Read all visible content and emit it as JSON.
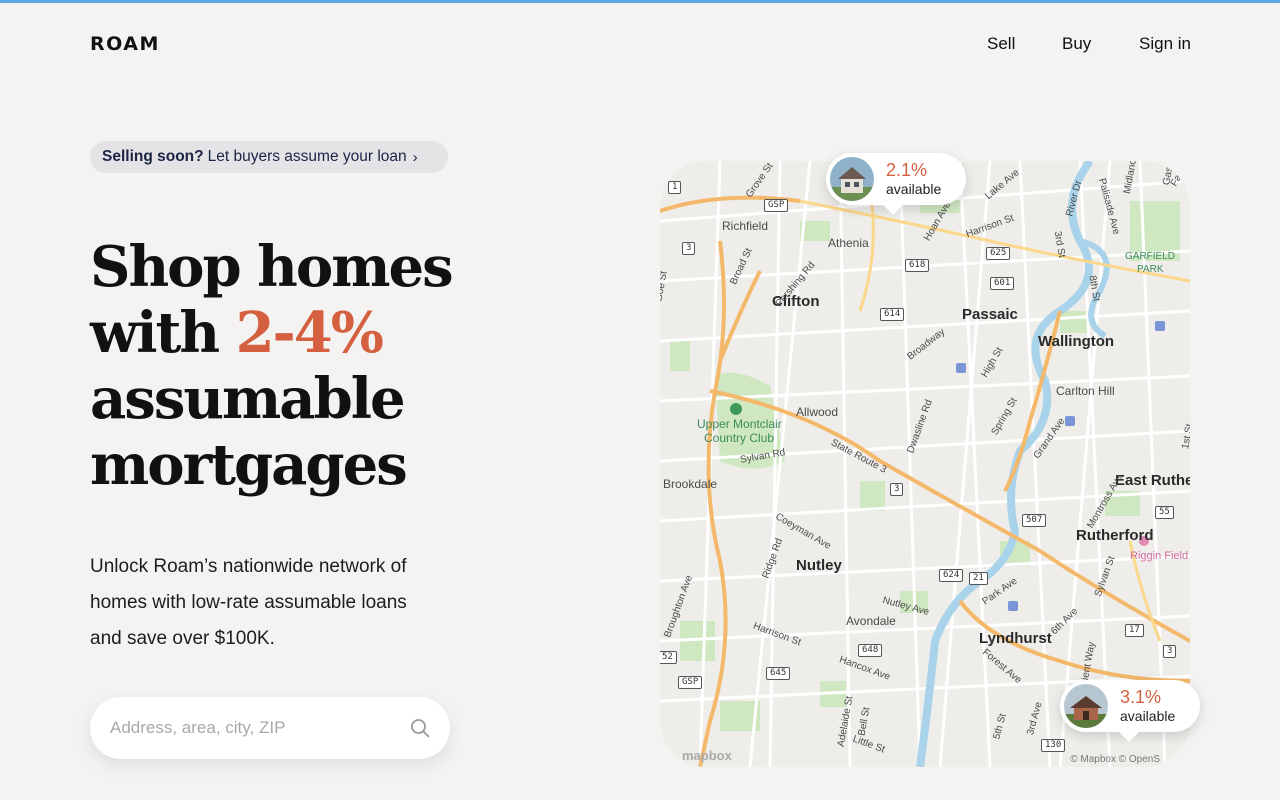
{
  "brand": {
    "logo": "ROAM",
    "accent_color": "#d5603f",
    "topbar_color": "#5aa9e0"
  },
  "nav": {
    "sell": "Sell",
    "buy": "Buy",
    "sign_in": "Sign in"
  },
  "promo": {
    "bold": "Selling soon?",
    "text": "Let buyers assume your loan",
    "icon": "chevron-right-icon"
  },
  "hero": {
    "line1": "Shop homes",
    "line2_prefix": "with",
    "line2_accent": "2-4%",
    "line3": "assumable",
    "line4": "mortgages",
    "subtitle": "Unlock Roam’s nationwide network of homes with low-rate assumable loans and save over $100K."
  },
  "search": {
    "placeholder": "Address, area, city, ZIP",
    "icon": "search-icon"
  },
  "map": {
    "cities": [
      "Clifton",
      "Passaic",
      "Wallington",
      "Nutley",
      "Lyndhurst",
      "Rutherford",
      "East Rutherf"
    ],
    "places": [
      "Richfield",
      "Athenia",
      "Allwood",
      "Brookdale",
      "Avondale",
      "Carlton Hill"
    ],
    "park": "Upper Montclair Country Club",
    "park_top": "Upper Montclair",
    "park_bottom": "Country Club",
    "garfield_top": "GARFIELD",
    "garfield_bottom": "PARK",
    "riggin": "Riggin Field",
    "roads": [
      "State Route 3",
      "Broadway",
      "Broad St",
      "Pershing Rd",
      "Grove St",
      "Harrison St",
      "High St",
      "Spring St",
      "Grand Ave",
      "Park Ave",
      "Montross Ave",
      "Nutley Ave",
      "Harrison St",
      "Hancox Ave",
      "Ridge Rd",
      "Coeyman Ave",
      "Sylvan Rd",
      "Dwasline Rd",
      "Lake Ave",
      "River Dr",
      "Palisade Ave",
      "Midland",
      "8th St",
      "3rd St",
      "Sylvan St",
      "6th Ave",
      "Forest Ave",
      "5th St",
      "Little St",
      "Adelaide St",
      "Bell St",
      "Farnh",
      "Gaski",
      "1st St",
      "Orient Way",
      "3rd Ave",
      "Hoan Ave",
      "Goe St",
      "Broughton Ave",
      "Rd"
    ],
    "shields": [
      "GSP",
      "3",
      "618",
      "625",
      "601",
      "614",
      "3",
      "507",
      "55",
      "624",
      "21",
      "17",
      "3",
      "648",
      "645",
      "GSP",
      "130",
      "1",
      "52"
    ],
    "attribution": "© Mapbox © OpenS",
    "mapbox_logo": "mapbox"
  },
  "listings": [
    {
      "rate": "2.1%",
      "label": "available"
    },
    {
      "rate": "3.1%",
      "label": "available"
    }
  ]
}
